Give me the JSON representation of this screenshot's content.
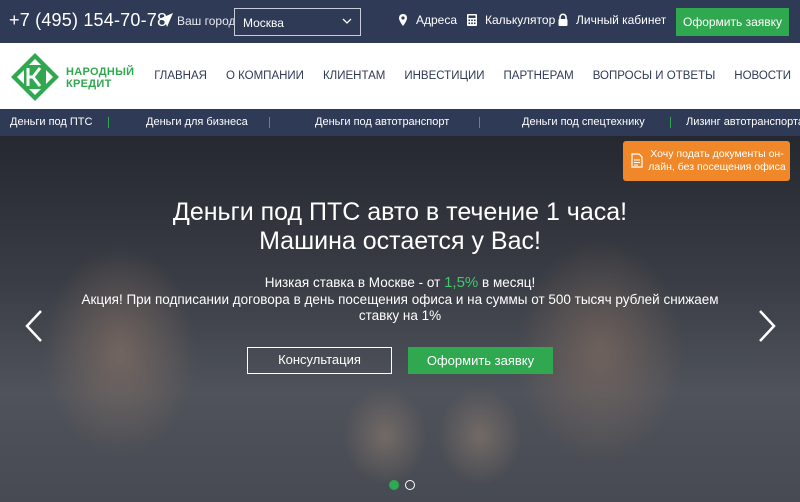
{
  "topbar": {
    "phone": "+7 (495) 154-70-78",
    "city_label": "Ваш город:",
    "city_value": "Москва",
    "links": [
      {
        "label": "Адреса",
        "icon": "map-pin-icon"
      },
      {
        "label": "Калькулятор",
        "icon": "calculator-icon"
      },
      {
        "label": "Личный кабинет",
        "icon": "lock-icon"
      }
    ],
    "apply_label": "Оформить заявку"
  },
  "brand": {
    "line1": "НАРОДНЫЙ",
    "line2": "КРЕДИТ",
    "accent_color": "#2fa84f",
    "dark_color": "#2f3a56",
    "orange_color": "#f0882a"
  },
  "nav": {
    "items": [
      "ГЛАВНАЯ",
      "О КОМПАНИИ",
      "КЛИЕНТАМ",
      "ИНВЕСТИЦИИ",
      "ПАРТНЕРАМ",
      "ВОПРОСЫ И ОТВЕТЫ",
      "НОВОСТИ"
    ]
  },
  "subnav": {
    "items": [
      "Деньги под ПТС",
      "Деньги для бизнеса",
      "Деньги под автотранспорт",
      "Деньги под спецтехнику",
      "Лизинг автотранспорта"
    ]
  },
  "hero": {
    "docs_button": "Хочу подать документы он-лайн, без посещения офиса",
    "title_line1": "Деньги под ПТС авто в течение 1 часа!",
    "title_line2": "Машина остается у Вас!",
    "rate_prefix": "Низкая ставка в Москве - от",
    "rate_value": "1,5%",
    "rate_suffix": "в месяц!",
    "promo": "Акция! При подписании договора в день посещения офиса и на суммы от 500 тысяч рублей снижаем ставку на 1%",
    "consult_label": "Консультация",
    "apply_label": "Оформить заявку",
    "slides_total": 2,
    "slide_active": 1
  }
}
